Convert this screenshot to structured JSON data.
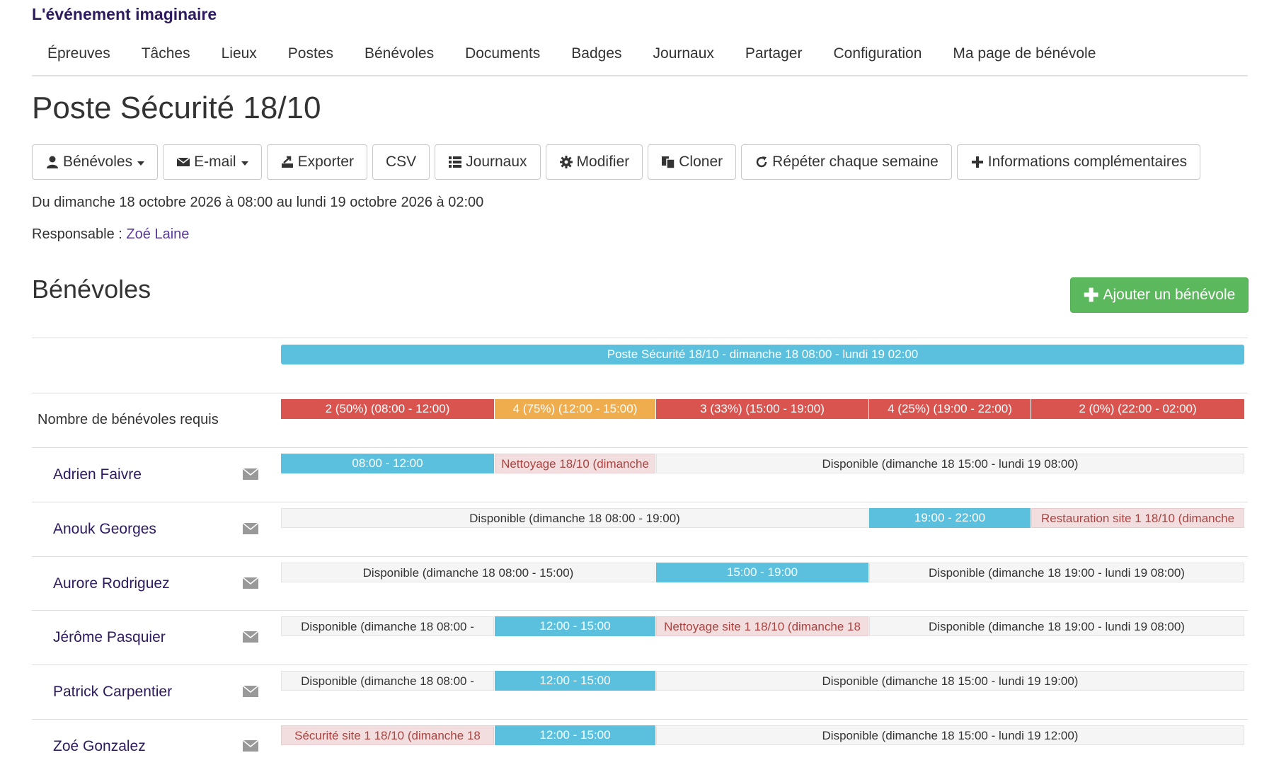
{
  "brand": "L'événement imaginaire",
  "nav": [
    "Épreuves",
    "Tâches",
    "Lieux",
    "Postes",
    "Bénévoles",
    "Documents",
    "Badges",
    "Journaux",
    "Partager",
    "Configuration",
    "Ma page de bénévole"
  ],
  "page_title": "Poste Sécurité 18/10",
  "toolbar": {
    "volunteers": "Bénévoles",
    "email": "E-mail",
    "export": "Exporter",
    "csv": "CSV",
    "logs": "Journaux",
    "edit": "Modifier",
    "clone": "Cloner",
    "repeat": "Répéter chaque semaine",
    "more_info": "Informations complémentaires"
  },
  "dates": "Du dimanche 18 octobre 2026 à 08:00 au lundi 19 octobre 2026 à 02:00",
  "responsible": {
    "label": "Responsable : ",
    "name": "Zoé Laine"
  },
  "section_title": "Bénévoles",
  "add_button": "Ajouter un bénévole",
  "timeline": {
    "main_bar": "Poste Sécurité 18/10 - dimanche 18 08:00 - lundi 19 02:00",
    "required_label": "Nombre de bénévoles requis",
    "required": [
      "2 (50%) (08:00 - 12:00)",
      "4 (75%) (12:00 - 15:00)",
      "3 (33%) (15:00 - 19:00)",
      "4 (25%) (19:00 - 22:00)",
      "2 (0%) (22:00 - 02:00)"
    ],
    "volunteers": [
      {
        "name": "Adrien Faivre",
        "slots": [
          "08:00 - 12:00",
          "Nettoyage 18/10 (dimanche",
          "Disponible (dimanche 18 15:00 - lundi 19 08:00)"
        ]
      },
      {
        "name": "Anouk Georges",
        "slots": [
          "Disponible (dimanche 18 08:00 - 19:00)",
          "19:00 - 22:00",
          "Restauration site 1 18/10 (dimanche"
        ]
      },
      {
        "name": "Aurore Rodriguez",
        "slots": [
          "Disponible (dimanche 18 08:00 - 15:00)",
          "15:00 - 19:00",
          "Disponible (dimanche 18 19:00 - lundi 19 08:00)"
        ]
      },
      {
        "name": "Jérôme Pasquier",
        "slots": [
          "Disponible (dimanche 18 08:00 -",
          "12:00 - 15:00",
          "Nettoyage site 1 18/10 (dimanche 18",
          "Disponible (dimanche 18 19:00 - lundi 19 08:00)"
        ]
      },
      {
        "name": "Patrick Carpentier",
        "slots": [
          "Disponible (dimanche 18 08:00 -",
          "12:00 - 15:00",
          "Disponible (dimanche 18 15:00 - lundi 19 19:00)"
        ]
      },
      {
        "name": "Zoé Gonzalez",
        "slots": [
          "Sécurité site 1 18/10 (dimanche 18",
          "12:00 - 15:00",
          "Disponible (dimanche 18 15:00 - lundi 19 12:00)"
        ]
      }
    ]
  },
  "icons": [
    "user-icon",
    "envelope-icon",
    "export-icon",
    "list-icon",
    "gear-icon",
    "copy-icon",
    "refresh-icon",
    "plus-icon",
    "mail-icon"
  ],
  "colors": {
    "brand": "#2e1a5e",
    "link": "#5b3a9e",
    "info": "#5bc0de",
    "danger": "#d9534f",
    "warning": "#f0ad4e",
    "success": "#5cb85c",
    "conflict_bg": "#f2dede",
    "conflict_text": "#a94442"
  }
}
